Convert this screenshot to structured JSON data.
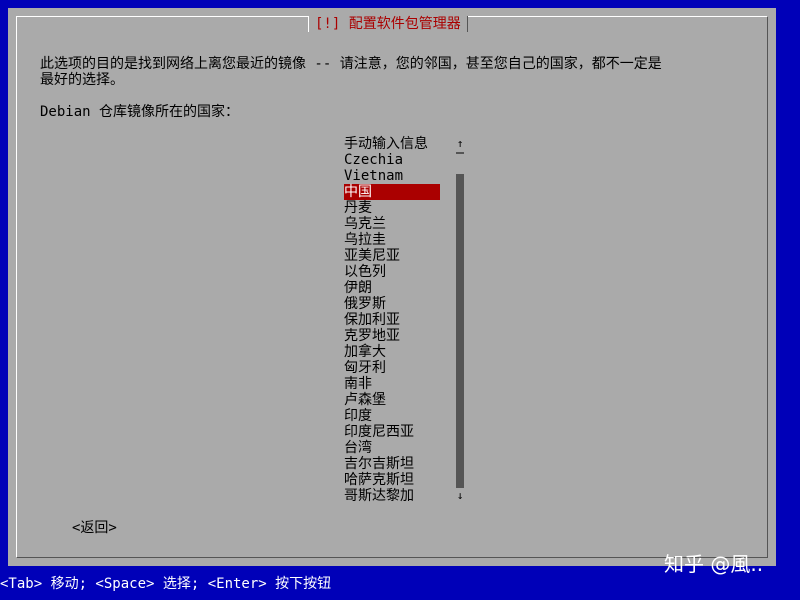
{
  "dialog": {
    "title": "[!] 配置软件包管理器",
    "description": "此选项的目的是找到网络上离您最近的镜像 -- 请注意，您的邻国，甚至您自己的国家，都不一定是\n最好的选择。",
    "prompt": "Debian 仓库镜像所在的国家：",
    "list_items": [
      "手动输入信息",
      "Czechia",
      "Vietnam",
      "中国",
      "丹麦",
      "乌克兰",
      "乌拉圭",
      "亚美尼亚",
      "以色列",
      "伊朗",
      "俄罗斯",
      "保加利亚",
      "克罗地亚",
      "加拿大",
      "匈牙利",
      "南非",
      "卢森堡",
      "印度",
      "印度尼西亚",
      "台湾",
      "吉尔吉斯坦",
      "哈萨克斯坦",
      "哥斯达黎加"
    ],
    "selected_index": 3,
    "scroll_up_glyph": "↑",
    "scroll_down_glyph": "↓",
    "back_label": "<返回>"
  },
  "statusbar": {
    "text": "<Tab> 移动; <Space> 选择; <Enter> 按下按钮"
  },
  "watermark": {
    "text": "知乎 @風.."
  },
  "colors": {
    "background": "#0000b8",
    "dialog": "#aaaaaa",
    "selection": "#aa0000",
    "title_text": "#aa0000"
  }
}
